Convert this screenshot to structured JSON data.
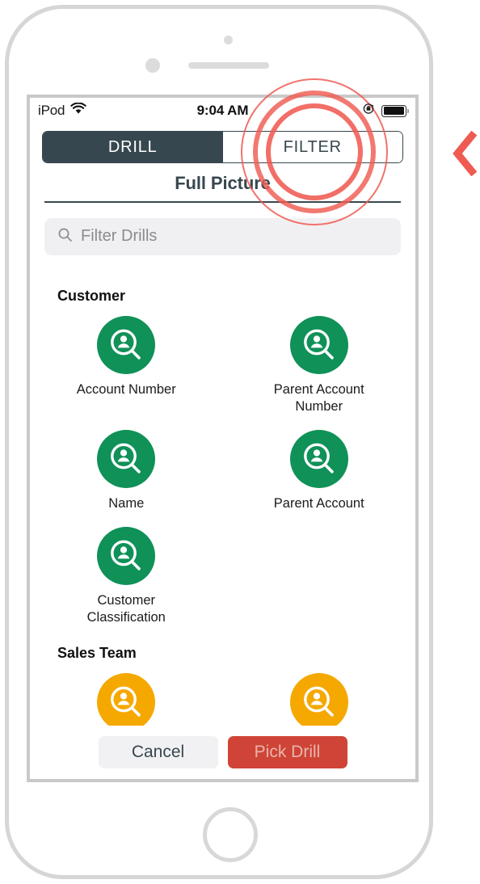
{
  "device": {
    "name": "iPod",
    "home_button": "home-button"
  },
  "status_bar": {
    "carrier": "iPod",
    "wifi_icon": "wifi-icon",
    "time": "9:04 AM",
    "rotation_lock_icon": "rotation-lock-icon",
    "battery_icon": "battery-icon"
  },
  "segmented_control": {
    "options": [
      {
        "label": "DRILL",
        "selected": true
      },
      {
        "label": "FILTER",
        "selected": false
      }
    ],
    "drill_label": "DRILL",
    "filter_label": "FILTER"
  },
  "header": {
    "title": "Full Picture"
  },
  "search": {
    "icon": "search-icon",
    "placeholder": "Filter Drills",
    "value": ""
  },
  "groups": [
    {
      "title": "Customer",
      "items": [
        {
          "label": "Account Number",
          "icon": "customer-search-icon",
          "color": "#0f9158"
        },
        {
          "label": "Parent Account Number",
          "icon": "customer-search-icon",
          "color": "#0f9158"
        },
        {
          "label": "Name",
          "icon": "customer-search-icon",
          "color": "#0f9158"
        },
        {
          "label": "Parent Account",
          "icon": "customer-search-icon",
          "color": "#0f9158"
        },
        {
          "label": "Customer Classification",
          "icon": "customer-search-icon",
          "color": "#0f9158"
        }
      ]
    },
    {
      "title": "Sales Team",
      "items": [
        {
          "label": "",
          "icon": "sales-search-icon",
          "color": "#f5a800"
        },
        {
          "label": "",
          "icon": "sales-search-icon",
          "color": "#f5a800"
        }
      ]
    }
  ],
  "group_customer": {
    "title": "Customer",
    "item_0": "Account Number",
    "item_1": "Parent Account Number",
    "item_2": "Name",
    "item_3": "Parent Account",
    "item_4": "Customer Classification"
  },
  "group_sales": {
    "title": "Sales Team"
  },
  "footer": {
    "cancel_label": "Cancel",
    "pick_label": "Pick Drill"
  },
  "annotation": {
    "highlight_target": "FILTER",
    "highlight_color": "#ef5b52",
    "chevron_icon": "chevron-left-icon",
    "chevron_color": "#ef5b52"
  },
  "colors": {
    "accent_dark": "#37474f",
    "customer_green": "#0f9158",
    "sales_amber": "#f5a800",
    "pick_red": "#cf4436",
    "annotation_red": "#ef5b52"
  }
}
